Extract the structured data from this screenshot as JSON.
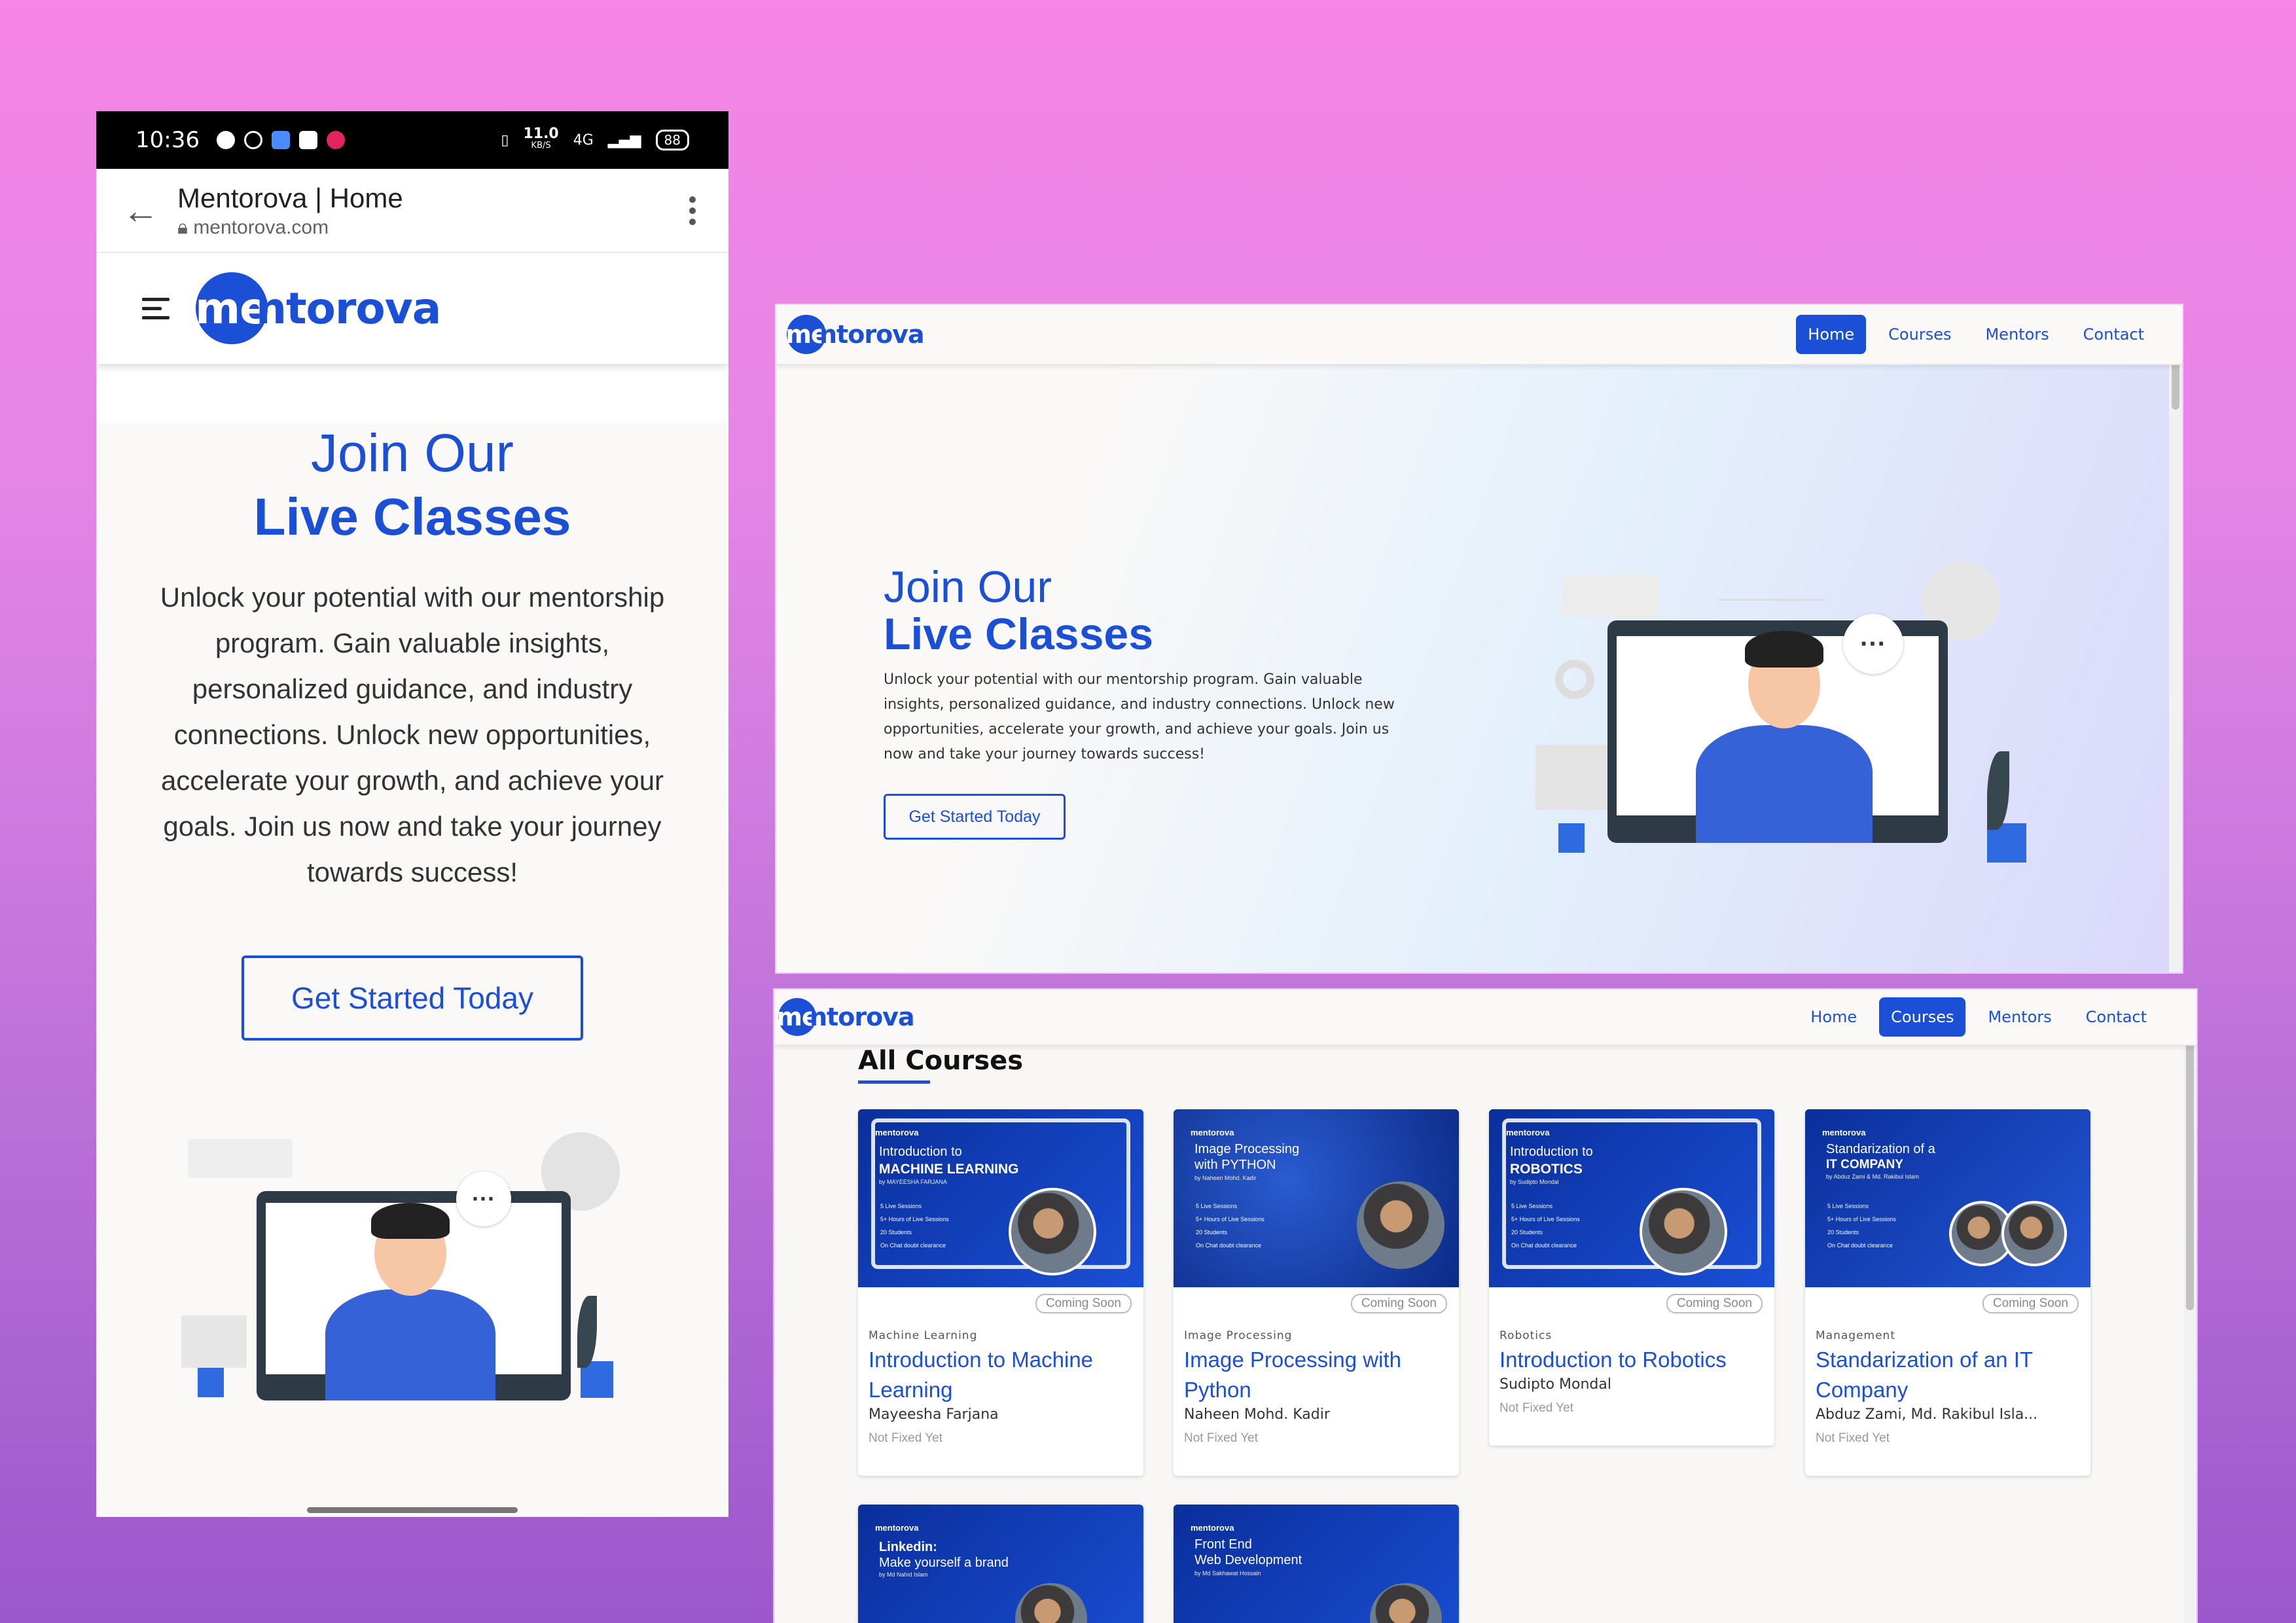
{
  "phone": {
    "status": {
      "time": "10:36",
      "speed": "11.0",
      "speed_unit": "KB/S",
      "net": "4G",
      "battery": "88"
    },
    "browser": {
      "title": "Mentorova | Home",
      "url": "mentorova.com"
    },
    "logo": {
      "me": "me",
      "rest": "ntorova"
    },
    "hero": {
      "join": "Join Our",
      "live": "Live Classes",
      "desc": "Unlock your potential with our mentorship program. Gain valuable insights, personalized guidance, and industry connections. Unlock new opportunities, accelerate your growth, and achieve your goals. Join us now and take your journey towards success!",
      "cta": "Get Started Today"
    }
  },
  "desktop_home": {
    "logo": {
      "me": "me",
      "rest": "ntorova"
    },
    "nav": [
      "Home",
      "Courses",
      "Mentors",
      "Contact"
    ],
    "active_nav": "Home",
    "hero": {
      "join": "Join Our",
      "live": "Live Classes",
      "desc": "Unlock your potential with our mentorship program. Gain valuable insights, personalized guidance, and industry connections. Unlock new opportunities, accelerate your growth, and achieve your goals. Join us now and take your journey towards success!",
      "cta": "Get Started Today"
    }
  },
  "desktop_courses": {
    "logo": {
      "me": "me",
      "rest": "ntorova"
    },
    "nav": [
      "Home",
      "Courses",
      "Mentors",
      "Contact"
    ],
    "active_nav": "Courses",
    "heading": "All Courses",
    "courses": [
      {
        "category": "Machine Learning",
        "title": "Introduction to Machine Learning",
        "author": "Mayeesha Farjana",
        "date": "Not Fixed Yet",
        "badge": "Coming Soon",
        "thumb_line1": "Introduction to",
        "thumb_line2": "MACHINE LEARNING",
        "thumb_by": "by MAYEESHA FARJANA"
      },
      {
        "category": "Image Processing",
        "title": "Image Processing with Python",
        "author": "Naheen Mohd. Kadir",
        "date": "Not Fixed Yet",
        "badge": "Coming Soon",
        "thumb_line1": "Image Processing",
        "thumb_line2": "with PYTHON",
        "thumb_by": "by Naheen Mohd. Kadir"
      },
      {
        "category": "Robotics",
        "title": "Introduction to Robotics",
        "author": "Sudipto Mondal",
        "date": "Not Fixed Yet",
        "badge": "Coming Soon",
        "thumb_line1": "Introduction to",
        "thumb_line2": "ROBOTICS",
        "thumb_by": "by Sudipto Mondal"
      },
      {
        "category": "Management",
        "title": "Standarization of an IT Company",
        "author": "Abduz Zami, Md. Rakibul Isla...",
        "date": "Not Fixed Yet",
        "badge": "Coming Soon",
        "thumb_line1": "Standarization of a",
        "thumb_line2": "IT COMPANY",
        "thumb_by": "by Abduz Zami & Md. Rakibul Islam"
      },
      {
        "thumb_line1": "Linkedin:",
        "thumb_line2": "Make yourself a brand",
        "thumb_by": "by Md Nahid Islam"
      },
      {
        "thumb_line1": "Front End",
        "thumb_line2": "Web Development",
        "thumb_by": "by Md Sakhawat Hossain"
      }
    ],
    "thumb_logo": "mentorova",
    "thumb_bullets": [
      "5 Live Sessions",
      "5+ Hours of Live Sessions",
      "20 Students",
      "On Chat doubt clearance"
    ]
  }
}
